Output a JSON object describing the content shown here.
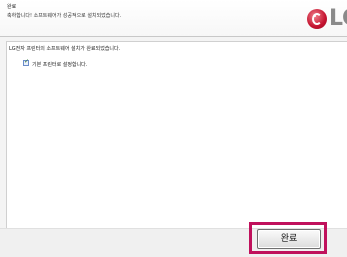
{
  "header": {
    "title": "완료",
    "subtitle": "축하합니다! 소프트웨어가 성공적으로 설치되었습니다.",
    "logo_text": "LG",
    "logo_icon": "lg-face-icon"
  },
  "body": {
    "message": "LG전자 프린터의 소프트웨어 설치가 완료되었습니다.",
    "checkbox": {
      "label": "기본 프린터로 설정합니다.",
      "checked": true
    }
  },
  "footer": {
    "finish_label": "완료",
    "highlight_color": "#c0115c"
  }
}
